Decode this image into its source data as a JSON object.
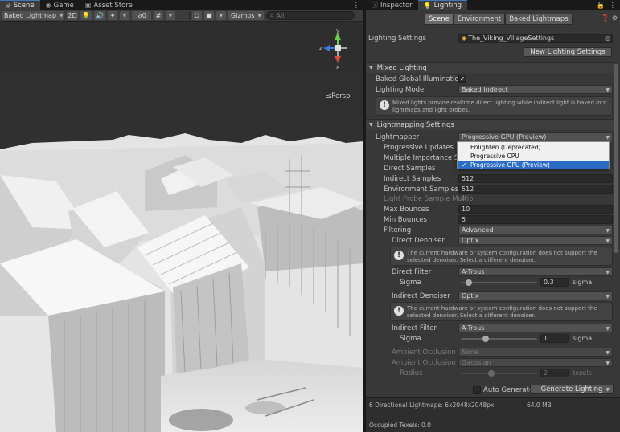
{
  "scene_tabs": [
    {
      "label": "Scene",
      "icon": "scene-icon"
    },
    {
      "label": "Game",
      "icon": "game-controller-icon"
    },
    {
      "label": "Asset Store",
      "icon": "store-icon"
    }
  ],
  "scene_toolbar": {
    "draw_mode": "Baked Lightmap",
    "two_d": "2D",
    "hidden_count": "0",
    "gizmos": "Gizmos",
    "search_placeholder": "All"
  },
  "viewport": {
    "projection_label": "≤Persp",
    "gizmo_axes": {
      "y": "y",
      "x": "x",
      "z": "z"
    }
  },
  "lighting_tabs": [
    {
      "label": "Inspector",
      "icon": "info-icon"
    },
    {
      "label": "Lighting",
      "icon": "lightbulb-icon"
    }
  ],
  "subtabs": [
    "Scene",
    "Environment",
    "Baked Lightmaps"
  ],
  "lighting_settings": {
    "label": "Lighting Settings",
    "value": "The_Viking_VillageSettings",
    "new_button": "New Lighting Settings"
  },
  "mixed_lighting": {
    "title": "Mixed Lighting",
    "baked_gi_label": "Baked Global Illumination",
    "baked_gi_checked": true,
    "mode_label": "Lighting Mode",
    "mode_value": "Baked Indirect",
    "help": "Mixed lights provide realtime direct lighting while indirect light is baked into lightmaps and light probes."
  },
  "lightmapping": {
    "title": "Lightmapping Settings",
    "lightmapper_label": "Lightmapper",
    "lightmapper_value": "Progressive GPU (Preview)",
    "progressive_updates_label": "Progressive Updates",
    "multiple_importance_label": "Multiple Importance Samp",
    "direct_samples_label": "Direct Samples",
    "indirect_samples_label": "Indirect Samples",
    "indirect_samples_value": "512",
    "environment_samples_label": "Environment Samples",
    "environment_samples_value": "512",
    "light_probe_label": "Light Probe Sample Multip",
    "light_probe_value": "4",
    "max_bounces_label": "Max Bounces",
    "max_bounces_value": "10",
    "min_bounces_label": "Min Bounces",
    "min_bounces_value": "5",
    "filtering_label": "Filtering",
    "filtering_value": "Advanced",
    "direct_denoiser_label": "Direct Denoiser",
    "direct_denoiser_value": "Optix",
    "denoiser_help": "The current hardware or system configuration does not support the selected denoiser. Select a different denoiser.",
    "direct_filter_label": "Direct Filter",
    "direct_filter_value": "A-Trous",
    "sigma_label": "Sigma",
    "direct_sigma_value": "0.3",
    "direct_sigma_fraction": 0.1,
    "sigma_unit": "sigma",
    "indirect_denoiser_label": "Indirect Denoiser",
    "indirect_denoiser_value": "Optix",
    "indirect_filter_label": "Indirect Filter",
    "indirect_filter_value": "A-Trous",
    "indirect_sigma_value": "1",
    "indirect_sigma_fraction": 0.33,
    "ao_denoiser_label": "Ambient Occlusion Der",
    "ao_denoiser_value": "None",
    "ao_filter_label": "Ambient Occlusion Filt",
    "ao_filter_value": "Gaussian",
    "radius_label": "Radius",
    "radius_value": "2",
    "radius_fraction": 0.4,
    "radius_unit": "texels"
  },
  "lightmapper_options": [
    {
      "label": "Enlighten (Deprecated)",
      "selected": false
    },
    {
      "label": "Progressive CPU",
      "selected": false
    },
    {
      "label": "Progressive GPU (Preview)",
      "selected": true
    }
  ],
  "generate": {
    "auto_label": "Auto Generate",
    "auto_checked": false,
    "button": "Generate Lighting"
  },
  "stats": {
    "lightmaps": "6 Directional Lightmaps: 6x2048x2048px",
    "size": "64.0 MB",
    "occupied": "Occupied Texels: 0.0"
  },
  "colors": {
    "accent": "#3a79bb",
    "popup_selected": "#2b6cc6",
    "gizmo_y": "#6ccf4c",
    "gizmo_x": "#d94f3c",
    "gizmo_z": "#3f79d8"
  }
}
